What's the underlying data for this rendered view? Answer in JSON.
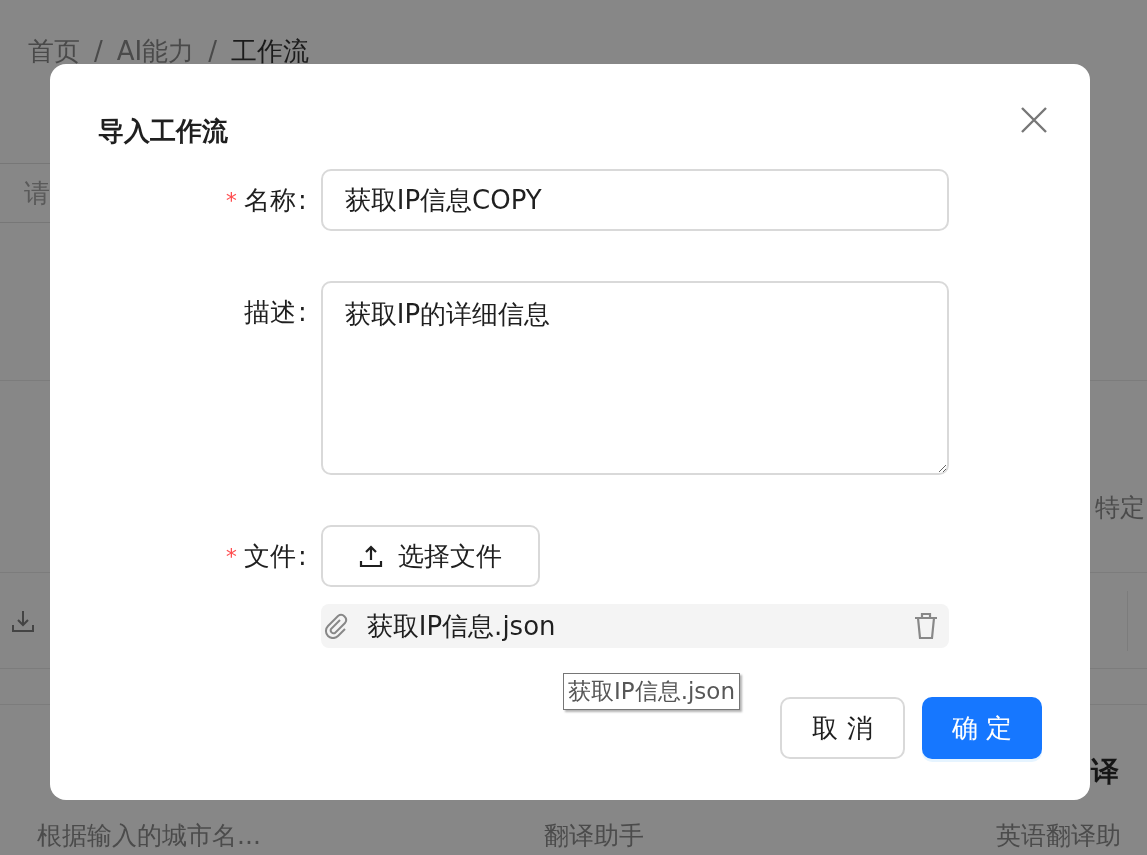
{
  "breadcrumb": {
    "separator": "/",
    "items": [
      {
        "label": "首页",
        "current": false
      },
      {
        "label": "AI能力",
        "current": false
      },
      {
        "label": "工作流",
        "current": true
      }
    ]
  },
  "search": {
    "placeholder": "请"
  },
  "columns": [
    {
      "bottom": {
        "description": "根据输入的城市名..."
      }
    },
    {
      "bottom": {
        "description": "翻译助手"
      }
    },
    {
      "top": {
        "description": "特定"
      },
      "bottom": {
        "title": "译",
        "description": "英语翻译助"
      }
    }
  ],
  "dialog": {
    "title": "导入工作流",
    "required_mark": "*",
    "label_suffix": ":",
    "fields": [
      {
        "kind": "input",
        "label": "名称",
        "required": true,
        "value": "获取IP信息COPY"
      },
      {
        "kind": "textarea",
        "label": "描述",
        "required": false,
        "value": "获取IP的详细信息"
      },
      {
        "kind": "upload",
        "label": "文件",
        "required": true,
        "button": "选择文件",
        "file": "获取IP信息.json",
        "tooltip": "获取IP信息.json"
      }
    ],
    "buttons": [
      {
        "label": "取 消",
        "kind": "default"
      },
      {
        "label": "确 定",
        "kind": "primary"
      }
    ]
  }
}
